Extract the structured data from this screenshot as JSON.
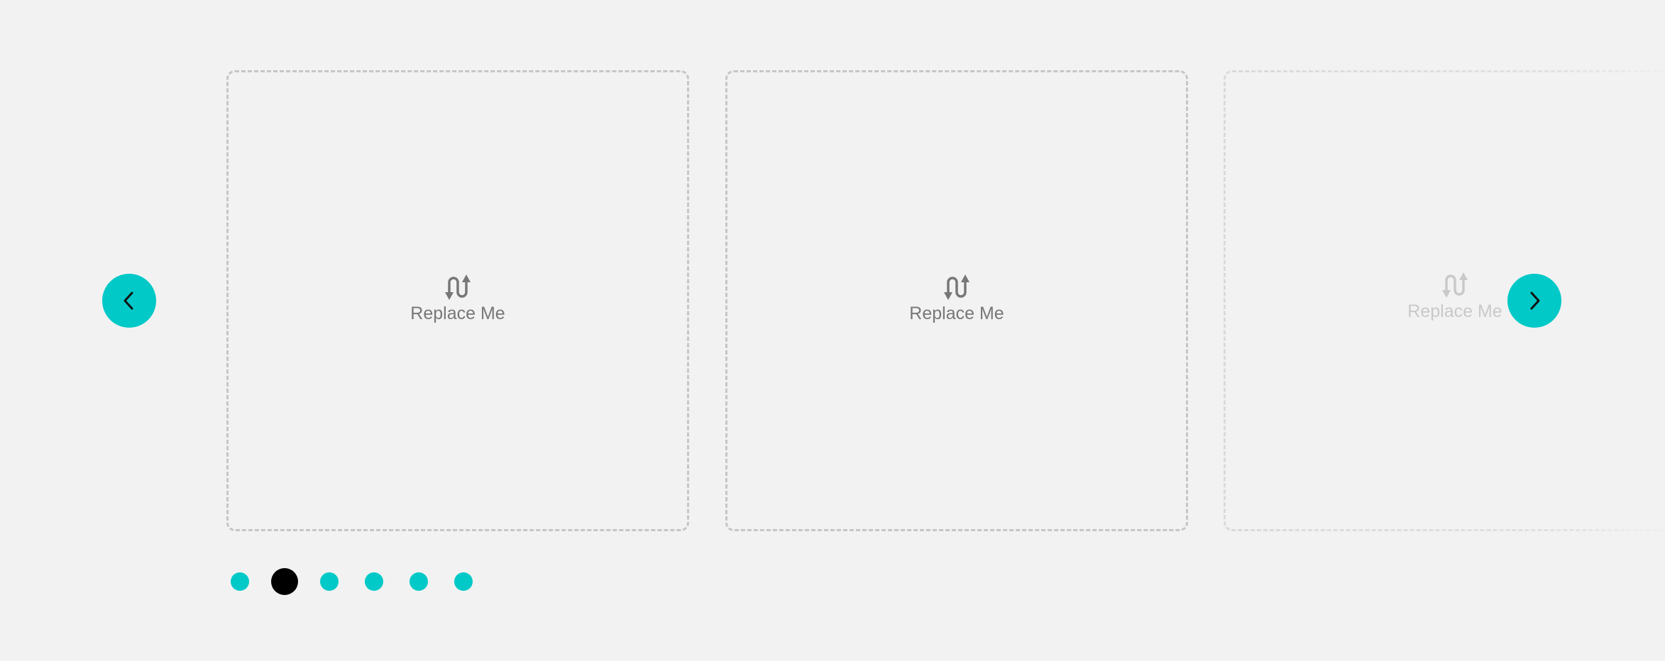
{
  "carousel": {
    "slides": [
      {
        "label": "Replace Me",
        "icon": "swap-vertical-icon"
      },
      {
        "label": "Replace Me",
        "icon": "swap-vertical-icon"
      },
      {
        "label": "Replace Me",
        "icon": "swap-vertical-icon"
      }
    ],
    "prev_icon": "chevron-left-icon",
    "next_icon": "chevron-right-icon",
    "pagination": {
      "count": 6,
      "active_index": 1
    }
  },
  "colors": {
    "background": "#f2f2f2",
    "accent": "#00c9c7",
    "active_dot": "#000000",
    "placeholder_text": "#777777",
    "slide_border": "#c6c6c6"
  }
}
